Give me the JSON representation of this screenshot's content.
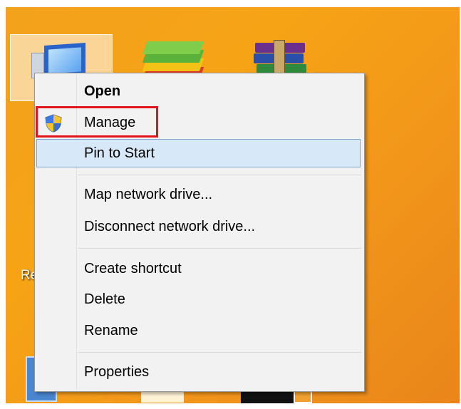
{
  "desktop": {
    "partial_label": "Re",
    "icons": [
      "computer-icon",
      "bluestacks-icon",
      "winrar-icon"
    ]
  },
  "context_menu": {
    "items": [
      {
        "label": "Open",
        "bold": true
      },
      {
        "label": "Manage",
        "icon": "uac-shield-icon",
        "highlighted": true
      },
      {
        "label": "Pin to Start",
        "hovered": true
      },
      {
        "label": "Map network drive..."
      },
      {
        "label": "Disconnect network drive..."
      },
      {
        "label": "Create shortcut"
      },
      {
        "label": "Delete"
      },
      {
        "label": "Rename"
      },
      {
        "label": "Properties"
      }
    ]
  },
  "colors": {
    "desktop_background": "#f6a316",
    "menu_background": "#f2f2f2",
    "hover_fill": "#d7e8f8",
    "hover_border": "#7da2ce",
    "annotation_box": "#e0141a"
  }
}
